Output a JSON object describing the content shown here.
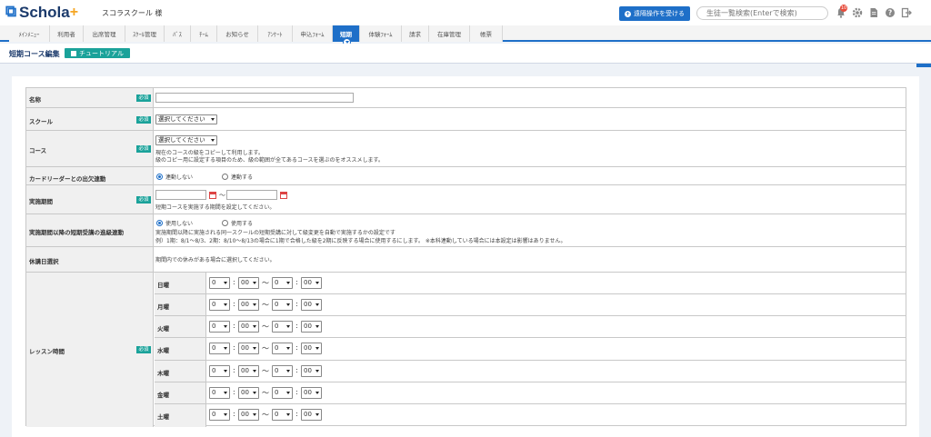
{
  "header": {
    "logo_text": "Schola",
    "logo_plus": "+",
    "school_name": "スコラスクール 様",
    "remote_button": "遠隔操作を受ける",
    "search_placeholder": "生徒一覧検索(Enterで検索)",
    "notification_count": "10",
    "icons": [
      "bell-icon",
      "gear-icon",
      "document-icon",
      "help-icon",
      "logout-icon"
    ]
  },
  "nav": {
    "items": [
      "ﾒｲﾝﾒﾆｭｰ",
      "利用者",
      "出席管理",
      "ｽｸｰﾙ管理",
      "ﾊﾞｽ",
      "ﾁｰﾑ",
      "お知らせ",
      "ｱﾝｹｰﾄ",
      "申込ﾌｫｰﾑ",
      "短期",
      "体験ﾌｫｰﾑ",
      "請求",
      "在庫管理",
      "帳票"
    ],
    "active_index": 9
  },
  "subbar": {
    "title": "短期コース編集",
    "tutorial_button": "チュートリアル"
  },
  "form": {
    "required_label": "必須",
    "fields": {
      "name": {
        "label": "名称",
        "value": ""
      },
      "school": {
        "label": "スクール",
        "selected": "選択してください"
      },
      "course": {
        "label": "コース",
        "selected": "選択してください",
        "help1": "現在のコースの級をコピーして利用します。",
        "help2": "級のコピー用に設定する項目のため、級の範囲が全てあるコースを選ぶのをオススメします。"
      },
      "card_reader": {
        "label": "カードリーダーとの出欠連動",
        "opt_off": "連動しない",
        "opt_on": "連動する",
        "selected": "連動しない"
      },
      "period": {
        "label": "実施期間",
        "start": "",
        "end": "",
        "tilde": "〜",
        "help": "短期コースを実施する期間を設定してください。"
      },
      "grade_link": {
        "label": "実施期間以降の短期受講の進級連動",
        "opt_off": "使用しない",
        "opt_on": "使用する",
        "selected": "使用しない",
        "help1": "実施期間以降に実施される同一スクールの短期受講に対して級変更を自動で実施するかの設定です",
        "help2": "例）1期：8/1〜8/3、2期：8/10〜8/13の場合に1期で合格した級を2期に反映する場合に使用するにします。 ※本科連動している場合には本設定は影響はありません。"
      },
      "holiday": {
        "label": "休講日選択",
        "help": "期間内での休みがある場合に選択してください。"
      },
      "lesson_time": {
        "label": "レッスン時間",
        "days": [
          "日曜",
          "月曜",
          "火曜",
          "水曜",
          "木曜",
          "金曜",
          "土曜"
        ],
        "start_hour": "0",
        "start_min": "00",
        "end_hour": "0",
        "end_min": "00",
        "colon": ":",
        "tilde": "〜"
      }
    }
  },
  "colors": {
    "primary": "#1e6fc8",
    "teal": "#1aa29a",
    "navy": "#1b3a6b"
  }
}
